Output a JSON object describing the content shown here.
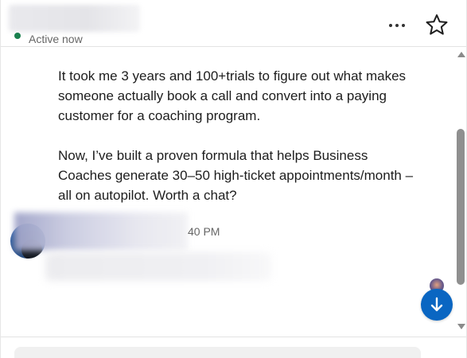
{
  "header": {
    "status_text": "Active now",
    "status_color": "#1a7f4e",
    "more_icon": "more-horizontal-icon",
    "star_icon": "star-outline-icon"
  },
  "conversation": {
    "message_paragraphs": [
      "It took me 3 years and 100+trials to figure out what makes someone actually book a call and convert into a paying customer for a coaching program.",
      "Now, I’ve built a proven formula that helps Business Coaches generate 30–50 high-ticket appointments/month – all on autopilot. Worth a chat?"
    ],
    "reply_timestamp": "40 PM",
    "jump_icon": "arrow-down-icon",
    "accent_color": "#0a66c2"
  },
  "scrollbar": {
    "up_icon": "scroll-up-arrow-icon",
    "down_icon": "scroll-down-arrow-icon"
  }
}
